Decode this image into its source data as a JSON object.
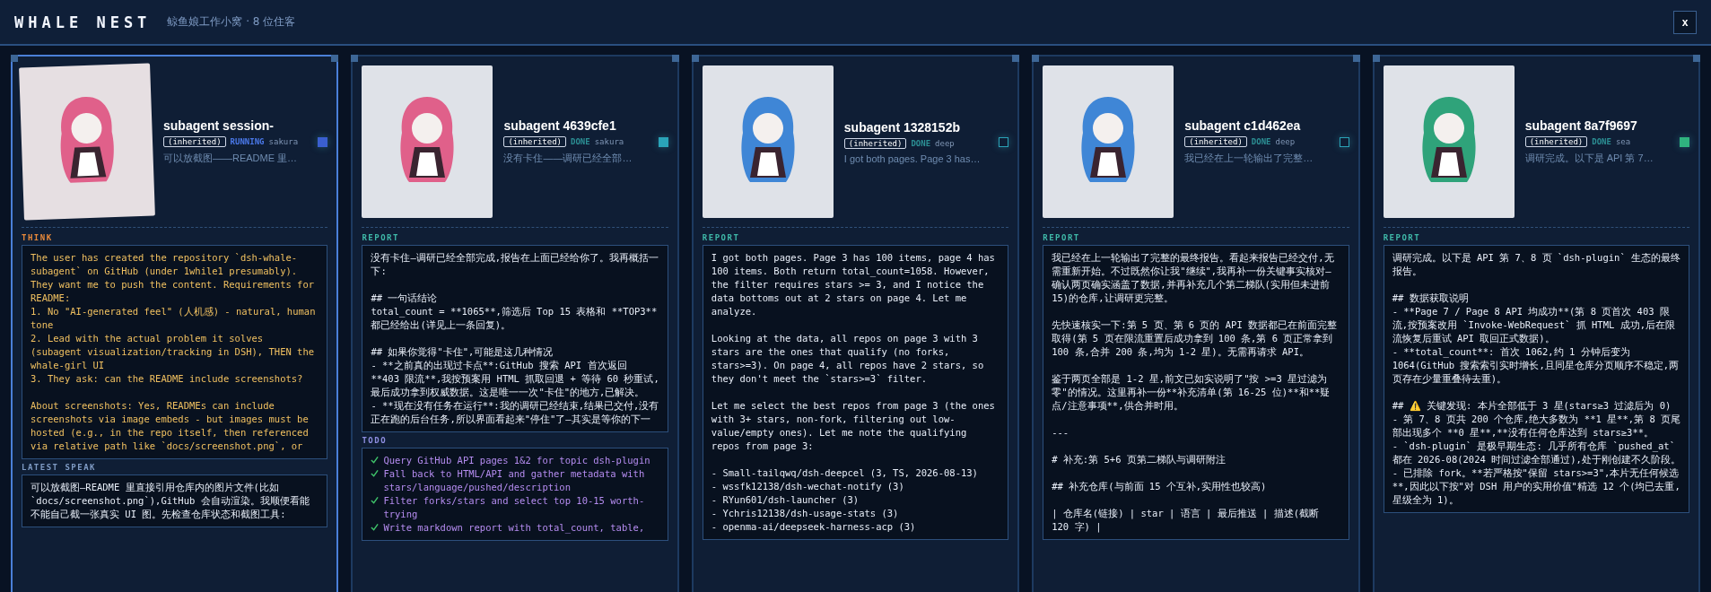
{
  "header": {
    "title": "WHALE NEST",
    "subtitle": "鲸鱼娘工作小窝 · 8 位住客",
    "close": "x"
  },
  "agents": [
    {
      "title": "subagent session-",
      "badge": "(inherited)",
      "status": {
        "label": "RUNNING",
        "kind": "running"
      },
      "name": "sakura",
      "preview": "可以放截图——README 里…",
      "selected": true,
      "avatar": {
        "color": "#e0608a",
        "tilted": true
      },
      "indicator": {
        "color": "#3a5fcf",
        "filled": true
      },
      "sections": [
        {
          "kind": "think",
          "label": "THINK",
          "blocks": [
            [
              "The user has created the repository `dsh-whale-subagent` on GitHub (under 1while1 presumably). They want me to push the content. Requirements for README:",
              "1. No \"AI-generated feel\" (人机感) - natural, human tone",
              "2. Lead with the actual problem it solves (subagent visualization/tracking in DSH), THEN the whale-girl UI",
              "3. They ask: can the README include screenshots?"
            ],
            [
              "About screenshots: Yes, READMEs can include screenshots via image embeds - but images must be hosted (e.g., in the repo itself, then referenced via relative path like `docs/screenshot.png`, or"
            ]
          ]
        },
        {
          "kind": "speak",
          "label": "LATEST SPEAK",
          "blocks": [
            [
              "可以放截图—README 里直接引用仓库内的图片文件(比如 `docs/screenshot.png`),GitHub 会自动渲染。我顺便看能不能自己截一张真实 UI 图。先检查仓库状态和截图工具:"
            ]
          ]
        }
      ]
    },
    {
      "title": "subagent 4639cfe1",
      "badge": "(inherited)",
      "status": {
        "label": "DONE",
        "kind": "done"
      },
      "name": "sakura",
      "preview": "没有卡住——调研已经全部…",
      "selected": false,
      "avatar": {
        "color": "#e0608a",
        "tilted": false
      },
      "indicator": {
        "color": "#2aa3b8",
        "filled": true
      },
      "sections": [
        {
          "kind": "report",
          "label": "REPORT",
          "blocks": [
            [
              "没有卡住—调研已经全部完成,报告在上面已经给你了。我再概括一下:"
            ],
            [
              "## 一句话结论",
              "total_count = **1065**,筛选后 Top 15 表格和 **TOP3** 都已经给出(详见上一条回复)。"
            ],
            [
              "## 如果你觉得\"卡住\",可能是这几种情况",
              "- **之前真的出现过卡点**:GitHub 搜索 API 首次返回 **403 限流**,我按预案用 HTML 抓取回退 + 等待 60 秒重试,最后成功拿到权威数据。这是唯一一次\"卡住\"的地方,已解决。",
              "- **现在没有任务在运行**:我的调研已经结束,结果已交付,没有正在跑的后台任务,所以界面看起来\"停住\"了—其实是等你的下一"
            ]
          ]
        },
        {
          "kind": "todo",
          "label": "TODO",
          "items": [
            {
              "text": "Query GitHub API pages 1&2 for topic dsh-plugin",
              "done": true
            },
            {
              "text": "Fall back to HTML/API and gather metadata with stars/language/pushed/description",
              "done": true
            },
            {
              "text": "Filter forks/stars and select top 10-15 worth-trying",
              "done": true
            },
            {
              "text": "Write markdown report with total_count, table,",
              "done": true
            }
          ]
        }
      ]
    },
    {
      "title": "subagent 1328152b",
      "badge": "(inherited)",
      "status": {
        "label": "DONE",
        "kind": "done"
      },
      "name": "deep",
      "preview": "I got both pages. Page 3 has…",
      "selected": false,
      "avatar": {
        "color": "#3f86d6",
        "tilted": false
      },
      "indicator": {
        "color": "#2aa3b8",
        "filled": false
      },
      "sections": [
        {
          "kind": "report",
          "label": "REPORT",
          "blocks": [
            [
              "I got both pages. Page 3 has 100 items, page 4 has 100 items. Both return total_count=1058. However, the filter requires stars >= 3, and I notice the data bottoms out at 2 stars on page 4. Let me analyze."
            ],
            [
              "Looking at the data, all repos on page 3 with 3 stars are the ones that qualify (no forks, stars>=3). On page 4, all repos have 2 stars, so they don't meet the `stars>=3` filter."
            ],
            [
              "Let me select the best repos from page 3 (the ones with 3+ stars, non-fork, filtering out low-value/empty ones). Let me note the qualifying repos from page 3:"
            ],
            [
              "- Small-tailqwq/dsh-deepcel (3, TS, 2026-08-13)",
              "- wssfk12138/dsh-wechat-notify (3)",
              "- RYun601/dsh-launcher (3)",
              "- Ychris12138/dsh-usage-stats (3)",
              "- openma-ai/deepseek-harness-acp (3)"
            ]
          ]
        }
      ]
    },
    {
      "title": "subagent c1d462ea",
      "badge": "(inherited)",
      "status": {
        "label": "DONE",
        "kind": "done"
      },
      "name": "deep",
      "preview": "我已经在上一轮输出了完整…",
      "selected": false,
      "avatar": {
        "color": "#3f86d6",
        "tilted": false
      },
      "indicator": {
        "color": "#2aa3b8",
        "filled": false
      },
      "sections": [
        {
          "kind": "report",
          "label": "REPORT",
          "blocks": [
            [
              "我已经在上一轮输出了完整的最终报告。看起来报告已经交付,无需重新开始。不过既然你让我\"继续\",我再补一份关键事实核对—确认两页确实涵盖了数据,并再补充几个第二梯队(实用但未进前15)的仓库,让调研更完整。"
            ],
            [
              "先快速核实一下:第 5 页、第 6 页的 API 数据都已在前面完整取得(第 5 页在限流重置后成功拿到 100 条,第 6 页正常拿到 100 条,合并 200 条,均为 1-2 星)。无需再请求 API。"
            ],
            [
              "鉴于两页全部是 1-2 星,前文已如实说明了\"按 >=3 星过滤为零\"的情况。这里再补一份**补充清单(第 16-25 位)**和**疑点/注意事项**,供合并时用。"
            ],
            [
              "---"
            ],
            [
              "# 补充:第 5+6 页第二梯队与调研附注"
            ],
            [
              "## 补充仓库(与前面 15 个互补,实用性也较高)"
            ],
            [
              "| 仓库名(链接) | star | 语言 | 最后推送 | 描述(截断 120 字) |"
            ]
          ]
        }
      ]
    },
    {
      "title": "subagent 8a7f9697",
      "badge": "(inherited)",
      "status": {
        "label": "DONE",
        "kind": "done"
      },
      "name": "sea",
      "preview": "调研完成。以下是 API 第 7…",
      "selected": false,
      "avatar": {
        "color": "#2fa37a",
        "tilted": false
      },
      "indicator": {
        "color": "#2fb37f",
        "filled": true
      },
      "sections": [
        {
          "kind": "report",
          "label": "REPORT",
          "blocks": [
            [
              "调研完成。以下是 API 第 7、8 页 `dsh-plugin` 生态的最终报告。"
            ],
            [
              "## 数据获取说明",
              "- **Page 7 / Page 8 API 均成功**(第 8 页首次 403 限流,按预案改用 `Invoke-WebRequest` 抓 HTML 成功,后在限流恢复后重试 API 取回正式数据)。",
              "- **total_count**: 首次 1062,约 1 分钟后变为 1064(GitHub 搜索索引实时增长,且同星仓库分页顺序不稳定,两页存在少量重叠待去重)。"
            ],
            [
              "## ⚠️ 关键发现: 本片全部低于 3 星(stars≥3 过滤后为 0)",
              "- 第 7、8 页共 200 个仓库,绝大多数为 **1 星**,第 8 页尾部出现多个 **0 星**,**没有任何仓库达到 stars≥3**。",
              "- `dsh-plugin` 是极早期生态: 几乎所有仓库 `pushed_at` 都在 2026-08(2024 时间过滤全部通过),处于刚创建不久阶段。",
              "- 已排除 fork。**若严格按\"保留 stars>=3\",本片无任何候选**,因此以下按\"对 DSH 用户的实用价值\"精选 12 个(均已去重,星级全为 1)。"
            ]
          ]
        }
      ]
    }
  ]
}
